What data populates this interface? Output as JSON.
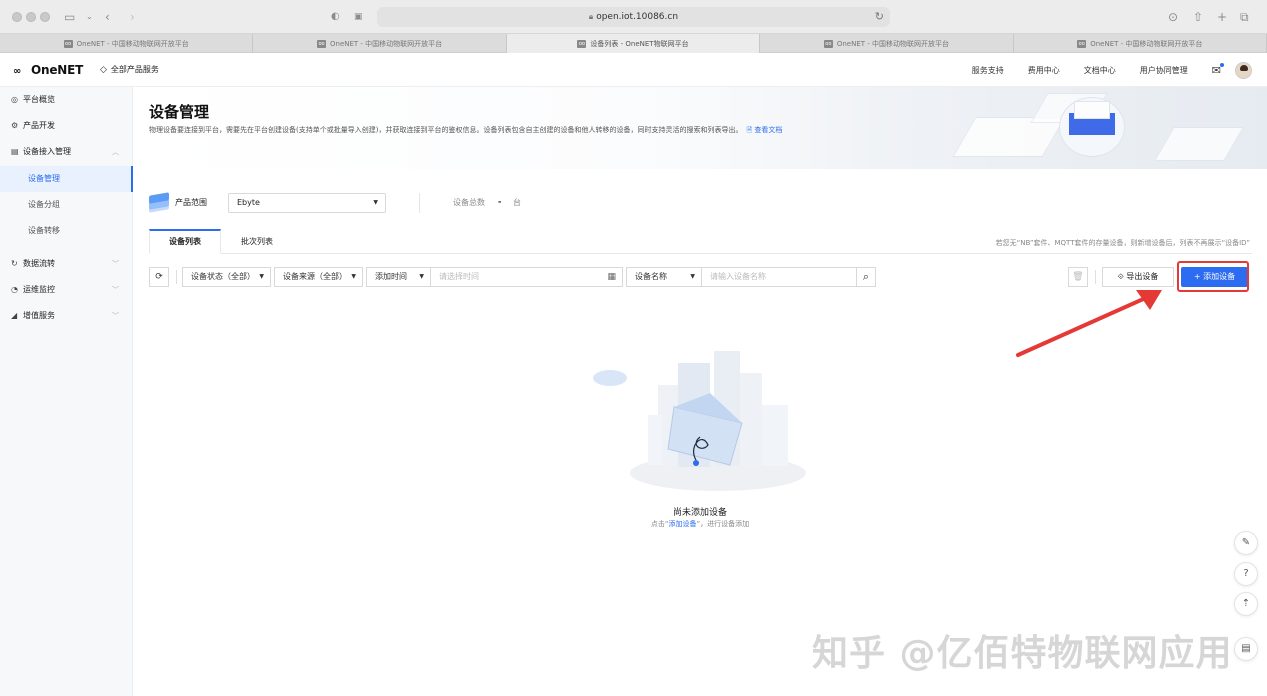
{
  "browser": {
    "url": "open.iot.10086.cn",
    "tabs": [
      {
        "label": "OneNET - 中国移动物联网开放平台",
        "active": false
      },
      {
        "label": "OneNET - 中国移动物联网开放平台",
        "active": false
      },
      {
        "label": "设备列表 - OneNET物联网平台",
        "active": true
      },
      {
        "label": "OneNET - 中国移动物联网开放平台",
        "active": false
      },
      {
        "label": "OneNET - 中国移动物联网开放平台",
        "active": false
      }
    ]
  },
  "topnav": {
    "logo": "OneNET",
    "all_products": "全部产品服务",
    "links": [
      "服务支持",
      "费用中心",
      "文档中心",
      "用户协同管理"
    ]
  },
  "sidebar": {
    "items": [
      {
        "label": "平台概览",
        "icon": "overview-icon"
      },
      {
        "label": "产品开发",
        "icon": "product-dev-icon"
      },
      {
        "label": "设备接入管理",
        "icon": "device-access-icon",
        "expanded": true
      },
      {
        "label": "数据流转",
        "icon": "data-flow-icon"
      },
      {
        "label": "运维监控",
        "icon": "monitor-icon"
      },
      {
        "label": "增值服务",
        "icon": "value-added-icon"
      }
    ],
    "subitems": [
      "设备管理",
      "设备分组",
      "设备转移"
    ],
    "active_sub": "设备管理"
  },
  "banner": {
    "title": "设备管理",
    "description": "物理设备要连接到平台，需要先在平台创建设备(支持单个或批量导入创建)，并获取连接到平台的鉴权信息。设备列表包含自主创建的设备和他人转移的设备，同时支持灵活的搜索和列表导出。",
    "doc_link": "查看文档"
  },
  "product": {
    "label": "产品范围",
    "selected": "Ebyte",
    "total_label": "设备总数",
    "total_value": "-",
    "total_unit": "台"
  },
  "tabs": [
    {
      "label": "设备列表",
      "active": true
    },
    {
      "label": "批次列表",
      "active": false
    }
  ],
  "hint": "若您无“NB”套件、MQTT套件的存量设备，则新增设备后，列表不再展示“设备ID”",
  "filters": {
    "status": "设备状态（全部）",
    "source": "设备来源（全部）",
    "time_field": "添加时间",
    "time_placeholder": "请选择时间",
    "name_field": "设备名称",
    "name_placeholder": "请输入设备名称"
  },
  "actions": {
    "export": "导出设备",
    "add": "添加设备"
  },
  "empty": {
    "title": "尚未添加设备",
    "sub_prefix": "点击“",
    "sub_link": "添加设备",
    "sub_suffix": "”，进行设备添加"
  },
  "watermark": "知乎 @亿佰特物联网应用",
  "colors": {
    "accent": "#2b6cf0",
    "annotation": "#e53935"
  }
}
